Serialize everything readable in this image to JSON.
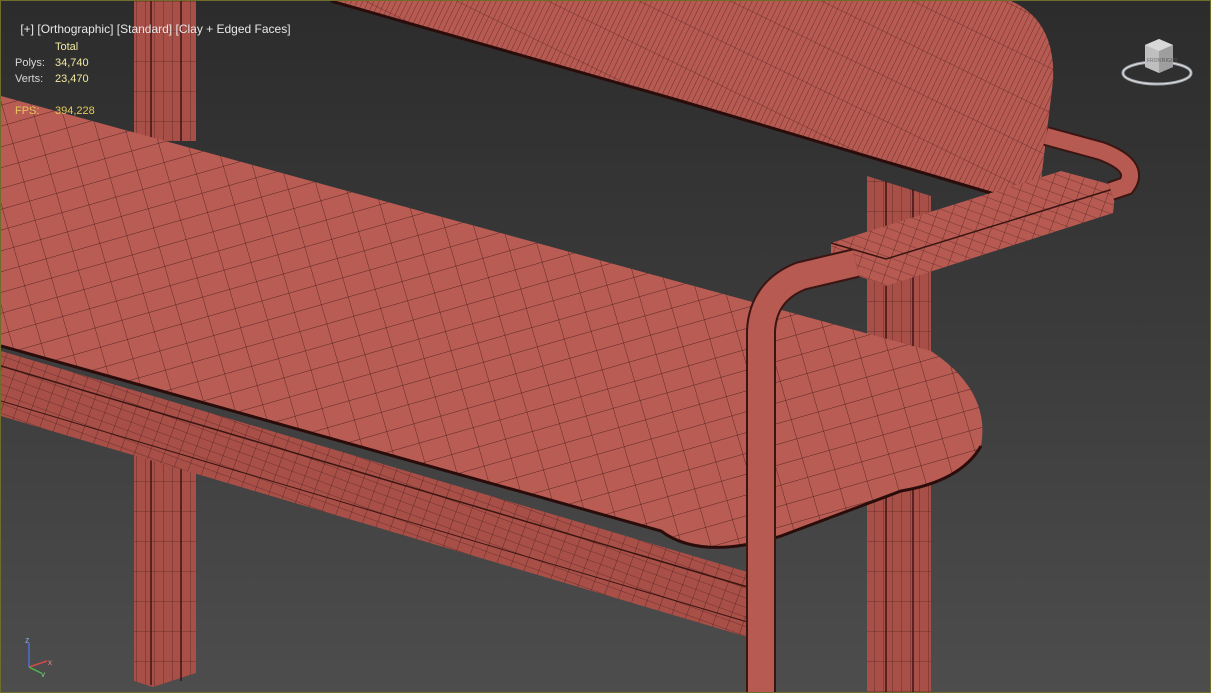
{
  "viewport": {
    "menu_plus": "[+]",
    "view_mode": "[Orthographic]",
    "preset": "[Standard]",
    "shading": "[Clay + Edged Faces]"
  },
  "stats": {
    "header": "Total",
    "polys_label": "Polys:",
    "polys_value": "34,740",
    "verts_label": "Verts:",
    "verts_value": "23,470",
    "fps_label": "FPS:",
    "fps_value": "394,228"
  },
  "viewcube": {
    "icon": "viewcube-icon",
    "front_label": "FRONT",
    "right_label": "RIGHT"
  },
  "axis": {
    "z_label": "z",
    "x_label": "x",
    "y_label": "y"
  },
  "colors": {
    "clay": "#b65a52",
    "wire": "#3a1512",
    "bg_top": "#2c2c2c",
    "bg_bottom": "#4d4d4d"
  }
}
